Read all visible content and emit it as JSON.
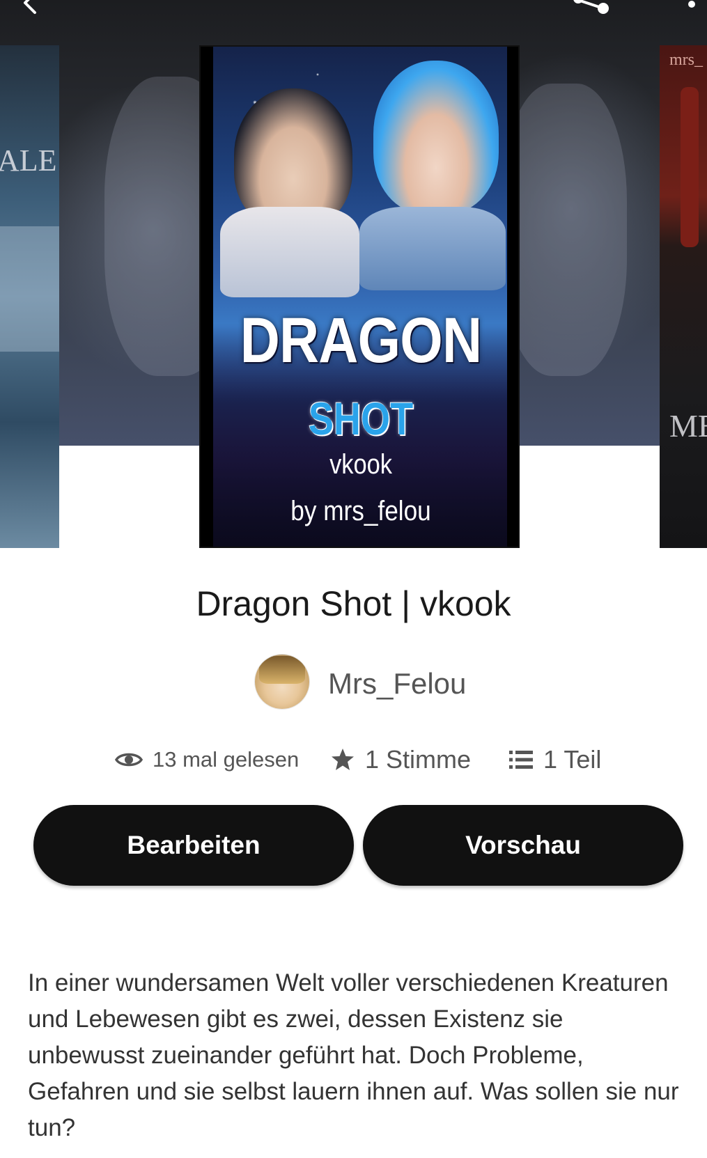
{
  "cover": {
    "title": "DRAGON",
    "subtitle": "SHOT",
    "tag": "vkook",
    "byline": "by mrs_felou"
  },
  "side_covers": {
    "left_text": "ALE",
    "right_top_text": "mrs_",
    "right_bottom_text": "ME"
  },
  "story": {
    "title": "Dragon Shot | vkook",
    "author": "Mrs_Felou"
  },
  "stats": {
    "reads": "13 mal gelesen",
    "votes": "1 Stimme",
    "parts": "1 Teil"
  },
  "actions": {
    "edit_label": "Bearbeiten",
    "preview_label": "Vorschau"
  },
  "description": "In einer wundersamen Welt voller verschiedenen Kreaturen und Lebewesen gibt es zwei, dessen Existenz sie unbewusst zueinander geführt hat. Doch Probleme, Gefahren und sie selbst lauern ihnen auf. Was sollen sie nur tun?",
  "icons": {
    "back": "back-arrow-icon",
    "share": "share-icon",
    "more": "more-vertical-icon",
    "reads": "eye-icon",
    "votes": "star-icon",
    "parts": "list-icon"
  },
  "colors": {
    "button_bg": "#111111",
    "button_text": "#ffffff",
    "title_text": "#1a1a1a",
    "muted_text": "#555555"
  }
}
